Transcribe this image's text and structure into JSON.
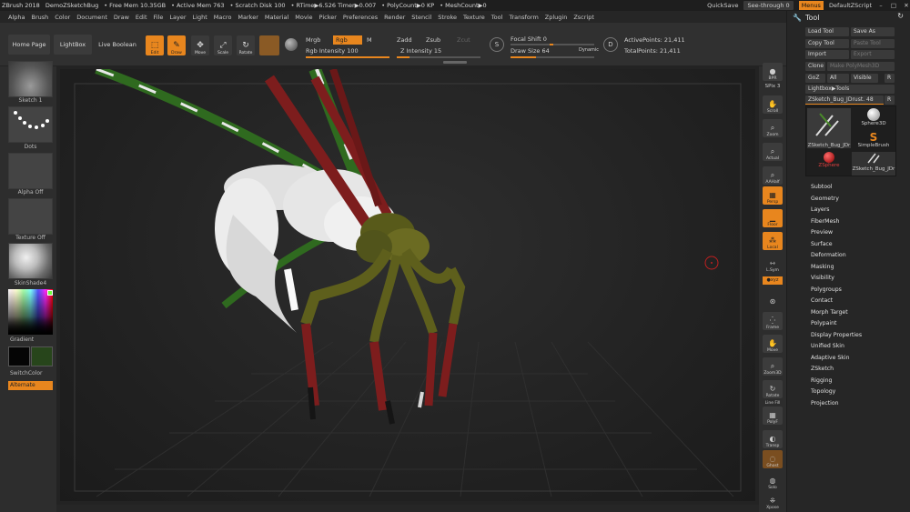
{
  "titlebar": {
    "app": "ZBrush 2018",
    "doc": "DemoZSketchBug",
    "free_mem": "• Free Mem 10.35GB",
    "active_mem": "• Active Mem 763",
    "scratch": "• Scratch Disk 100",
    "rtime": "• RTime▶6.526 Timer▶0.007",
    "polycount": "• PolyCount▶0 KP",
    "meshcount": "• MeshCount▶0",
    "quicksave": "QuickSave",
    "see_through": "See-through  0",
    "menus": "Menus",
    "default_zscript": "DefaultZScript"
  },
  "menubar": {
    "items": [
      "Alpha",
      "Brush",
      "Color",
      "Document",
      "Draw",
      "Edit",
      "File",
      "Layer",
      "Light",
      "Macro",
      "Marker",
      "Material",
      "Movie",
      "Picker",
      "Preferences",
      "Render",
      "Stencil",
      "Stroke",
      "Texture",
      "Tool",
      "Transform",
      "Zplugin",
      "Zscript"
    ]
  },
  "topshelf": {
    "home_page": "Home Page",
    "lightbox": "LightBox",
    "live_boolean": "Live Boolean",
    "edit": "Edit",
    "draw": "Draw",
    "move": "Move",
    "scale": "Scale",
    "rotate": "Rotate",
    "mrgb": "Mrgb",
    "rgb": "Rgb",
    "m": "M",
    "zadd": "Zadd",
    "zsub": "Zsub",
    "zcut": "Zcut",
    "rgb_intensity": "Rgb Intensity 100",
    "z_intensity": "Z Intensity 15",
    "focal_shift": "Focal Shift 0",
    "draw_size": "Draw Size 64",
    "dynamic": "Dynamic",
    "active_points": "ActivePoints: 21,411",
    "total_points": "TotalPoints: 21,411"
  },
  "leftshelf": {
    "brush": "Sketch 1",
    "stroke": "Dots",
    "alpha": "Alpha Off",
    "texture": "Texture Off",
    "material": "SkinShade4",
    "gradient": "Gradient",
    "switch_color": "SwitchColor",
    "alternate": "Alternate"
  },
  "rightshelf": {
    "bpr": "BPR",
    "spix": "SPix 3",
    "scroll": "Scroll",
    "zoom": "Zoom",
    "actual": "Actual",
    "aahalf": "AAHalf",
    "persp": "Persp",
    "floor": "Floor",
    "local": "Local",
    "lsym": "L.Sym",
    "xyz": "●xyz",
    "frame": "Frame",
    "move": "Move",
    "zoom3d": "Zoom3D",
    "rotate": "Rotate",
    "line_fill": "Line Fill",
    "polyf": "PolyF",
    "transp": "Transp",
    "ghost": "Ghost",
    "solo": "Solo",
    "xpose": "Xpose"
  },
  "tool": {
    "title": "Tool",
    "load_tool": "Load Tool",
    "save_as": "Save As",
    "copy_tool": "Copy Tool",
    "paste_tool": "Paste Tool",
    "import": "Import",
    "export": "Export",
    "clone": "Clone",
    "make_polymesh": "Make PolyMesh3D",
    "goz": "GoZ",
    "all": "All",
    "visible": "Visible",
    "r": "R",
    "lightbox_tools": "Lightbox▶Tools",
    "current_tool": "ZSketch_Bug_JDrust. 48",
    "thumbs": [
      "ZSketch_Bug_JDr",
      "Sphere3D",
      "SimpleBrush",
      "ZSphere",
      "ZSketch_Bug_JDr"
    ],
    "subpalettes": [
      "Subtool",
      "Geometry",
      "Layers",
      "FiberMesh",
      "Preview",
      "Surface",
      "Deformation",
      "Masking",
      "Visibility",
      "Polygroups",
      "Contact",
      "Morph Target",
      "Polypaint",
      "Display Properties",
      "Unified Skin",
      "Adaptive Skin",
      "ZSketch",
      "Rigging",
      "Topology",
      "Projection"
    ]
  },
  "colors": {
    "accent": "#e8861e",
    "panel": "#2d2d2d",
    "canvas": "#232323"
  }
}
